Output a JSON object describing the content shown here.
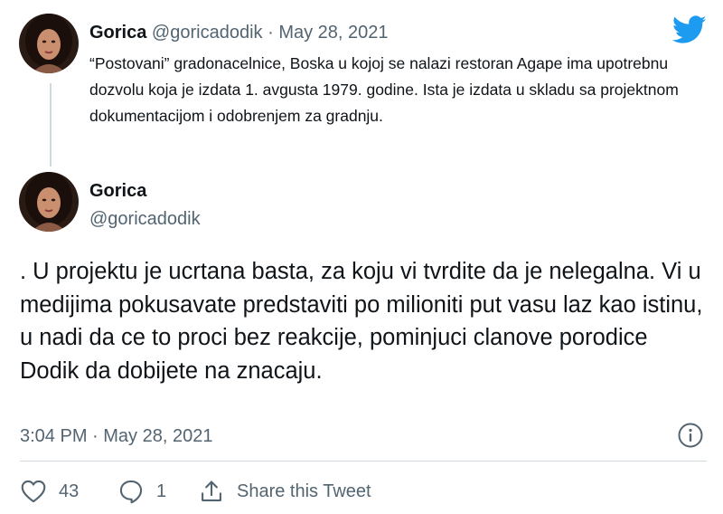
{
  "reply_tweet": {
    "author_name": "Gorica",
    "author_handle": "@goricadodik",
    "separator": "·",
    "date": "May 28, 2021",
    "text": "“Postovani” gradonacelnice, Boska u kojoj se nalazi restoran Agape ima upotrebnu dozvolu koja je izdata 1. avgusta 1979. godine. Ista je izdata u skladu sa projektnom dokumentacijom i odobrenjem za gradnju."
  },
  "main_tweet": {
    "author_name": "Gorica",
    "author_handle": "@goricadodik",
    "text": ". U projektu je ucrtana basta, za koju vi tvrdite da je nelegalna. Vi u medijima pokusavate predstaviti po milioniti put vasu laz kao istinu, u nadi da ce to proci bez reakcije, pominjuci clanove porodice Dodik da dobijete na znacaju.",
    "timestamp": "3:04 PM · May 28, 2021"
  },
  "actions": {
    "like_count": "43",
    "reply_count": "1",
    "share_label": "Share this Tweet"
  },
  "icons": {
    "brand": "twitter-bird-icon",
    "info": "info-icon",
    "like": "heart-icon",
    "reply": "speech-bubble-icon",
    "share": "share-arrow-icon"
  },
  "colors": {
    "twitter_blue": "#1d9bf0",
    "text_primary": "#0f1419",
    "text_secondary": "#536471",
    "divider": "#cfd9de"
  }
}
